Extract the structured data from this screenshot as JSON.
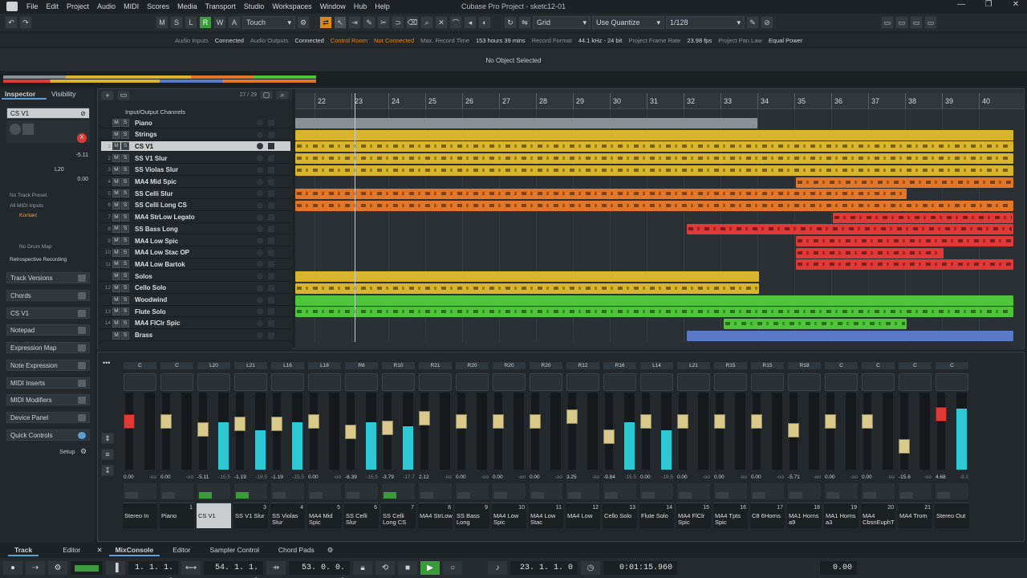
{
  "window": {
    "title": "Cubase Pro Project - sketc12-01"
  },
  "menu": [
    "File",
    "Edit",
    "Project",
    "Audio",
    "MIDI",
    "Scores",
    "Media",
    "Transport",
    "Studio",
    "Workspaces",
    "Window",
    "Hub",
    "Help"
  ],
  "toolbar": {
    "state_buttons": [
      "M",
      "S",
      "L",
      "R",
      "W",
      "A"
    ],
    "automation_mode": "Touch",
    "grid_type": "Grid",
    "quantize_mode": "Use Quantize",
    "quantize_value": "1/128"
  },
  "status_line": [
    {
      "label": "Audio Inputs",
      "value": "Connected"
    },
    {
      "label": "Audio Outputs",
      "value": "Connected"
    },
    {
      "label": "Control Room",
      "value": "Not Connected"
    },
    {
      "label": "Max. Record Time",
      "value": "153 hours 39 mins"
    },
    {
      "label": "Record Format",
      "value": "44.1 kHz - 24 bit"
    },
    {
      "label": "Project Frame Rate",
      "value": "23.98 fps"
    },
    {
      "label": "Project Pan Law",
      "value": "Equal Power"
    }
  ],
  "info_line": {
    "text": "No Object Selected"
  },
  "inspector": {
    "tabs": [
      "Inspector",
      "Visibility"
    ],
    "track_name": "CS V1",
    "volume": "-5.11",
    "pan": "L20",
    "delay": "0.00",
    "preset": "No Track Preset",
    "input": "All MIDI Inputs",
    "output": "Kontakt",
    "drum_map": "No Drum Map",
    "retro": "Retrospective Recording",
    "sections": [
      "Track Versions",
      "Chords",
      "CS V1",
      "Notepad",
      "Expression Map",
      "Note Expression",
      "MIDI Inserts",
      "MIDI Modifiers",
      "Device Panel",
      "Quick Controls"
    ],
    "setup": "Setup"
  },
  "project": {
    "track_count": "27 / 29",
    "io_channels": "Input/Output Channels",
    "ruler_bars": [
      "22",
      "23",
      "24",
      "25",
      "26",
      "27",
      "28",
      "29",
      "30",
      "31",
      "32",
      "33",
      "34",
      "35",
      "36",
      "37",
      "38",
      "39",
      "40"
    ],
    "tracks": [
      {
        "num": "",
        "name": "Piano",
        "color": "s",
        "folder": true
      },
      {
        "num": "",
        "name": "Strings",
        "color": "y",
        "folder": true
      },
      {
        "num": "1",
        "name": "CS V1",
        "color": "y",
        "selected": true
      },
      {
        "num": "2",
        "name": "SS V1 Slur",
        "color": "y"
      },
      {
        "num": "3",
        "name": "SS Violas Slur",
        "color": "y"
      },
      {
        "num": "4",
        "name": "MA4 Mid Spic",
        "color": "o"
      },
      {
        "num": "5",
        "name": "SS Celli Slur",
        "color": "o"
      },
      {
        "num": "6",
        "name": "SS Celli Long CS",
        "color": "o"
      },
      {
        "num": "7",
        "name": "MA4 StrLow Legato",
        "color": "r"
      },
      {
        "num": "8",
        "name": "SS Bass Long",
        "color": "r"
      },
      {
        "num": "9",
        "name": "MA4 Low Spic",
        "color": "r"
      },
      {
        "num": "10",
        "name": "MA4 Low Stac OP",
        "color": "r"
      },
      {
        "num": "11",
        "name": "MA4 Low Bartok",
        "color": "r"
      },
      {
        "num": "",
        "name": "Solos",
        "color": "y",
        "folder": true
      },
      {
        "num": "12",
        "name": "Cello Solo",
        "color": "y"
      },
      {
        "num": "",
        "name": "Woodwind",
        "color": "g",
        "folder": true
      },
      {
        "num": "13",
        "name": "Flute Solo",
        "color": "g"
      },
      {
        "num": "14",
        "name": "MA4 FlClr Spic",
        "color": "g"
      },
      {
        "num": "",
        "name": "Brass",
        "color": "b",
        "folder": true
      }
    ]
  },
  "mixer": {
    "channels": [
      {
        "pan": "C",
        "vol": "0.00",
        "peak": "-oo",
        "name": "Stereo In",
        "num": ""
      },
      {
        "pan": "C",
        "vol": "0.00",
        "peak": "-oo",
        "name": "Piano",
        "num": "1"
      },
      {
        "pan": "L20",
        "vol": "-5.11",
        "peak": "-15.5",
        "name": "CS V1",
        "num": "2",
        "selected": true
      },
      {
        "pan": "L21",
        "vol": "-1.19",
        "peak": "-19.5",
        "name": "SS V1 Slur",
        "num": "3"
      },
      {
        "pan": "L16",
        "vol": "-1.19",
        "peak": "-15.5",
        "name": "SS Violas Slur",
        "num": "4"
      },
      {
        "pan": "L18",
        "vol": "0.00",
        "peak": "-oo",
        "name": "MA4 Mid Spic",
        "num": "5"
      },
      {
        "pan": "R6",
        "vol": "-6.39",
        "peak": "-15.5",
        "name": "SS Celli Slur",
        "num": "6"
      },
      {
        "pan": "R10",
        "vol": "-3.79",
        "peak": "-17.7",
        "name": "SS Celli Long CS",
        "num": "7"
      },
      {
        "pan": "R21",
        "vol": "2.12",
        "peak": "-oo",
        "name": "MA4 StrLow",
        "num": "8"
      },
      {
        "pan": "R20",
        "vol": "0.00",
        "peak": "-oo",
        "name": "SS Bass Long",
        "num": "9"
      },
      {
        "pan": "R20",
        "vol": "0.00",
        "peak": "-oo",
        "name": "MA4 Low Spic",
        "num": "10"
      },
      {
        "pan": "R20",
        "vol": "0.00",
        "peak": "-oo",
        "name": "MA4 Low Stac",
        "num": "11"
      },
      {
        "pan": "R12",
        "vol": "3.25",
        "peak": "-oo",
        "name": "MA4 Low",
        "num": "12"
      },
      {
        "pan": "R16",
        "vol": "-9.84",
        "peak": "-15.5",
        "name": "Cello Solo",
        "num": "13"
      },
      {
        "pan": "L14",
        "vol": "0.00",
        "peak": "-19.5",
        "name": "Flute Solo",
        "num": "14"
      },
      {
        "pan": "L21",
        "vol": "0.00",
        "peak": "-oo",
        "name": "MA4 FlClr Spic",
        "num": "15"
      },
      {
        "pan": "R15",
        "vol": "0.00",
        "peak": "-oo",
        "name": "MA4 Tpts Spic",
        "num": "16"
      },
      {
        "pan": "R15",
        "vol": "0.00",
        "peak": "-oo",
        "name": "C8 6Horns",
        "num": "17"
      },
      {
        "pan": "R18",
        "vol": "-5.71",
        "peak": "-oo",
        "name": "MA1 Horns a9",
        "num": "18"
      },
      {
        "pan": "C",
        "vol": "0.00",
        "peak": "-oo",
        "name": "MA1 Horns a3",
        "num": "19"
      },
      {
        "pan": "C",
        "vol": "0.00",
        "peak": "-oo",
        "name": "MA4 CbsnEuphT",
        "num": "20"
      },
      {
        "pan": "C",
        "vol": "-15.6",
        "peak": "-oo",
        "name": "MA4 Trom",
        "num": "21"
      },
      {
        "pan": "C",
        "vol": "4.68",
        "peak": "-8.2",
        "name": "Stereo Out",
        "num": ""
      }
    ]
  },
  "bottom_tabs": {
    "left": [
      "Track",
      "Editor"
    ],
    "right": [
      "MixConsole",
      "Editor",
      "Sampler Control",
      "Chord Pads"
    ]
  },
  "transport": {
    "left_locator": "1. 1. 1. 0",
    "right_locator": "54. 1. 1. 0",
    "punch": "53. 0. 0. 0",
    "position": "23. 1. 1. 0",
    "time": "0:01:15.960",
    "level": "0.00"
  }
}
